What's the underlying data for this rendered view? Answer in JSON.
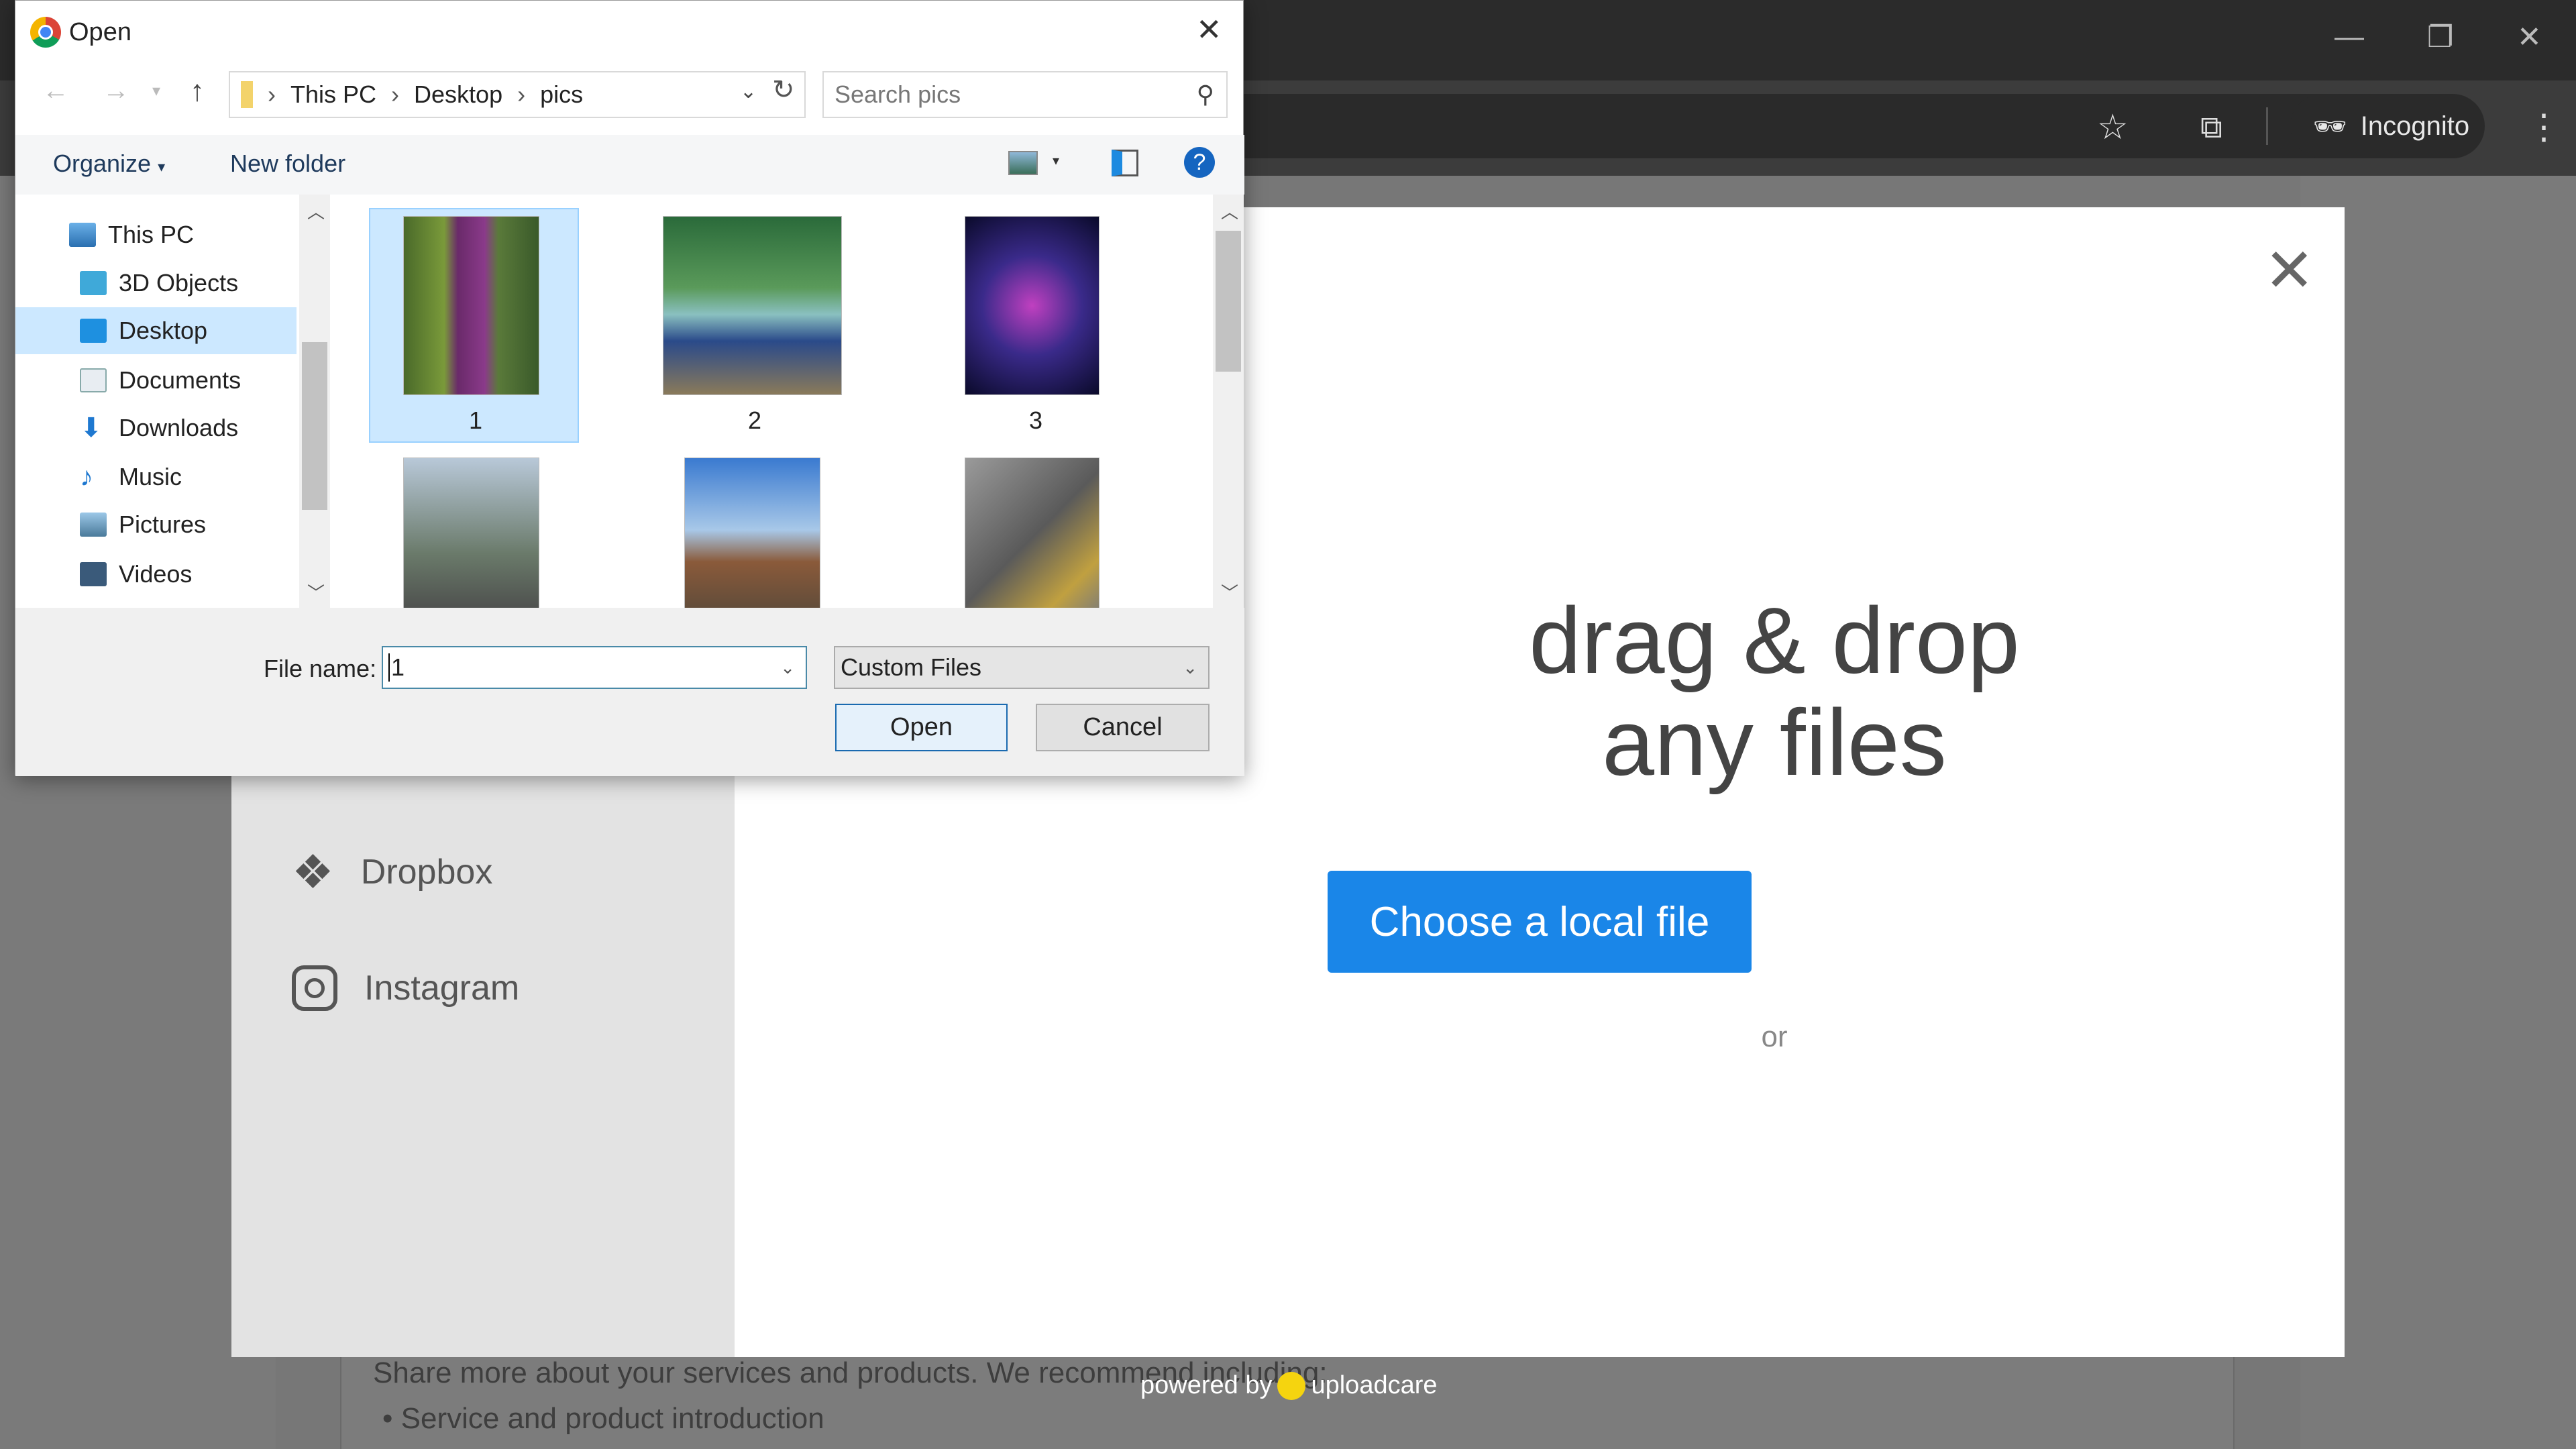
{
  "browser": {
    "incognito_label": "Incognito",
    "icons": [
      "minimize-icon",
      "restore-icon",
      "close-icon",
      "star-icon",
      "extensions-icon",
      "incognito-icon",
      "menu-icon"
    ]
  },
  "page": {
    "share_text": "Share more about your services and products. We recommend including:",
    "bullet": "Service and product introduction",
    "powered_by": "powered by",
    "brand": "uploadcare"
  },
  "uploader": {
    "sources": [
      {
        "label": "Dropbox"
      },
      {
        "label": "Instagram"
      }
    ],
    "drop_line1": "drag & drop",
    "drop_line2": "any files",
    "or": "or",
    "choose_button": "Choose a local file",
    "accent": "#1a86e8"
  },
  "dialog": {
    "title": "Open",
    "breadcrumb": [
      "This PC",
      "Desktop",
      "pics"
    ],
    "search_placeholder": "Search pics",
    "organize": "Organize",
    "new_folder": "New folder",
    "nav": [
      {
        "label": "This PC"
      },
      {
        "label": "3D Objects"
      },
      {
        "label": "Desktop",
        "selected": true
      },
      {
        "label": "Documents"
      },
      {
        "label": "Downloads"
      },
      {
        "label": "Music"
      },
      {
        "label": "Pictures"
      },
      {
        "label": "Videos"
      }
    ],
    "files": [
      {
        "label": "1",
        "selected": true
      },
      {
        "label": "2"
      },
      {
        "label": "3"
      },
      {
        "label": ""
      },
      {
        "label": ""
      },
      {
        "label": ""
      }
    ],
    "file_name_label": "File name:",
    "file_name_value": "1",
    "file_type": "Custom Files",
    "open_button": "Open",
    "cancel_button": "Cancel"
  }
}
